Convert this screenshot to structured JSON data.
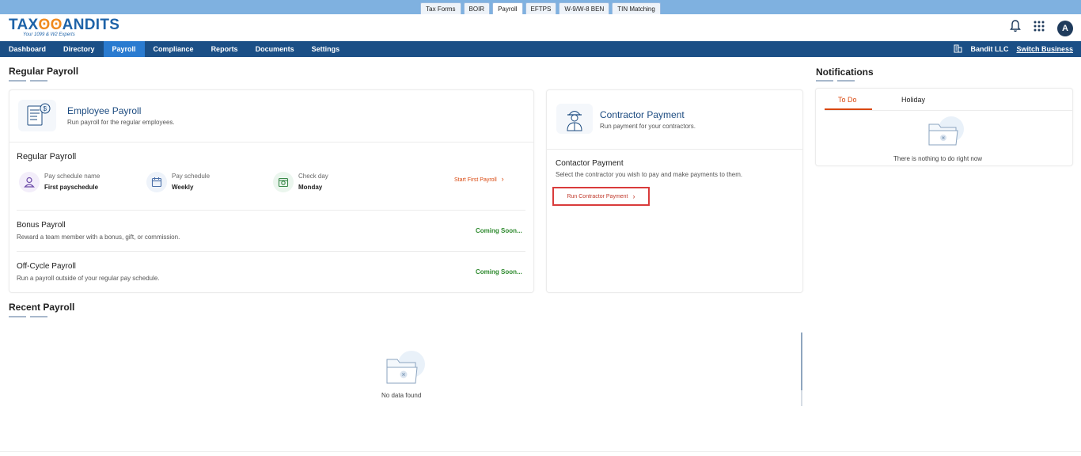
{
  "product_tabs": [
    "Tax Forms",
    "BOIR",
    "Payroll",
    "EFTPS",
    "W-9/W-8 BEN",
    "TIN Matching"
  ],
  "product_tab_active": "Payroll",
  "logo": {
    "text_a": "TAX",
    "text_b": "ANDITS",
    "owl": "ʘʘ",
    "tagline": "Your 1099 & W2 Experts"
  },
  "header": {
    "avatar": "A",
    "icons": [
      "bell-icon",
      "apps-grid-icon"
    ]
  },
  "nav": {
    "items": [
      "Dashboard",
      "Directory",
      "Payroll",
      "Compliance",
      "Reports",
      "Documents",
      "Settings"
    ],
    "active": "Payroll",
    "business": "Bandit LLC",
    "switch_label": "Switch Business"
  },
  "page": {
    "regular_payroll_title": "Regular Payroll",
    "recent_payroll_title": "Recent Payroll",
    "notifications_title": "Notifications"
  },
  "employee_card": {
    "title": "Employee Payroll",
    "subtitle": "Run payroll for the regular employees.",
    "section_title": "Regular Payroll",
    "fields": [
      {
        "label": "Pay schedule name",
        "value": "First payschedule"
      },
      {
        "label": "Pay schedule",
        "value": "Weekly"
      },
      {
        "label": "Check day",
        "value": "Monday"
      }
    ],
    "start_link": "Start First Payroll",
    "bonus": {
      "title": "Bonus Payroll",
      "desc": "Reward a team member with a bonus, gift, or commission.",
      "status": "Coming Soon..."
    },
    "offcycle": {
      "title": "Off-Cycle Payroll",
      "desc": "Run a payroll outside of your regular pay schedule.",
      "status": "Coming Soon..."
    }
  },
  "contractor_card": {
    "title": "Contractor Payment",
    "subtitle": "Run payment for your contractors.",
    "section_title": "Contactor Payment",
    "desc": "Select the contractor you wish to pay and make payments to them.",
    "button": "Run Contractor Payment"
  },
  "notifications": {
    "tabs": [
      "To Do",
      "Holiday"
    ],
    "active_tab": "To Do",
    "empty": "There is nothing to do right now"
  },
  "recent": {
    "empty": "No data found"
  },
  "colors": {
    "nav_bg": "#1b4f86",
    "nav_active": "#2a7bd0",
    "accent_orange": "#d9480f",
    "coming_green": "#2e8a2e",
    "highlight_red": "#d93b3b"
  }
}
